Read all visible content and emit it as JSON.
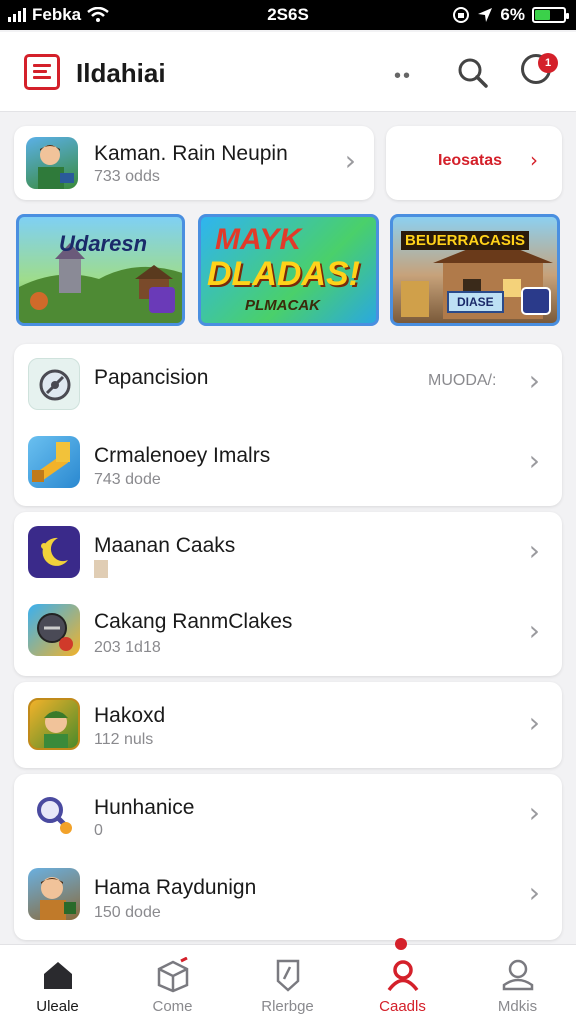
{
  "status_bar": {
    "carrier": "Febka",
    "time": "2S6S",
    "battery": "6%",
    "battery_color": "#3bd14a"
  },
  "header": {
    "title": "Ildahiai",
    "notification_count": "1",
    "more_label": "••"
  },
  "featured": {
    "title": "Kaman. Rain Neupin",
    "subtitle": "733 odds",
    "side_link": "Ieosatas"
  },
  "banners": [
    {
      "title": "Udaresn"
    },
    {
      "line1": "MAYK",
      "line2": "DLADAS!",
      "line3": "PLMACAK"
    },
    {
      "title": "BEUERRACASIS",
      "badge": "DIASE"
    }
  ],
  "list_groups": [
    {
      "items": [
        {
          "title": "Papancision",
          "meta": "MUODA/:",
          "subtitle": "",
          "icon": "compass-app-icon"
        },
        {
          "title": "Crmalenoey Imalrs",
          "meta": "",
          "subtitle": "743 dode",
          "icon": "hammer-app-icon"
        }
      ]
    },
    {
      "items": [
        {
          "title": "Maanan Caaks",
          "meta": "",
          "subtitle": "",
          "icon": "moon-app-icon"
        },
        {
          "title": "Cakang RanmClakes",
          "meta": "",
          "subtitle": "203 1d18",
          "icon": "disc-app-icon"
        }
      ]
    },
    {
      "items": [
        {
          "title": "Hakoxd",
          "meta": "",
          "subtitle": "112 nuls",
          "icon": "warrior-app-icon"
        }
      ]
    },
    {
      "items": [
        {
          "title": "Hunhanice",
          "meta": "",
          "subtitle": "0",
          "icon": "magnifier-app-icon"
        },
        {
          "title": "Hama Raydunign",
          "meta": "",
          "subtitle": "150 dode",
          "icon": "hero-app-icon"
        }
      ]
    }
  ],
  "tabs": [
    {
      "label": "Uleale",
      "icon": "home-icon",
      "state": "home"
    },
    {
      "label": "Come",
      "icon": "box-icon",
      "state": "normal"
    },
    {
      "label": "Rlerbge",
      "icon": "shield-icon",
      "state": "normal"
    },
    {
      "label": "Caadls",
      "icon": "person-red-icon",
      "state": "active"
    },
    {
      "label": "Mdkis",
      "icon": "person-icon",
      "state": "normal"
    }
  ],
  "colors": {
    "accent": "#d4202a",
    "background": "#f2f2f4",
    "card": "#ffffff"
  }
}
